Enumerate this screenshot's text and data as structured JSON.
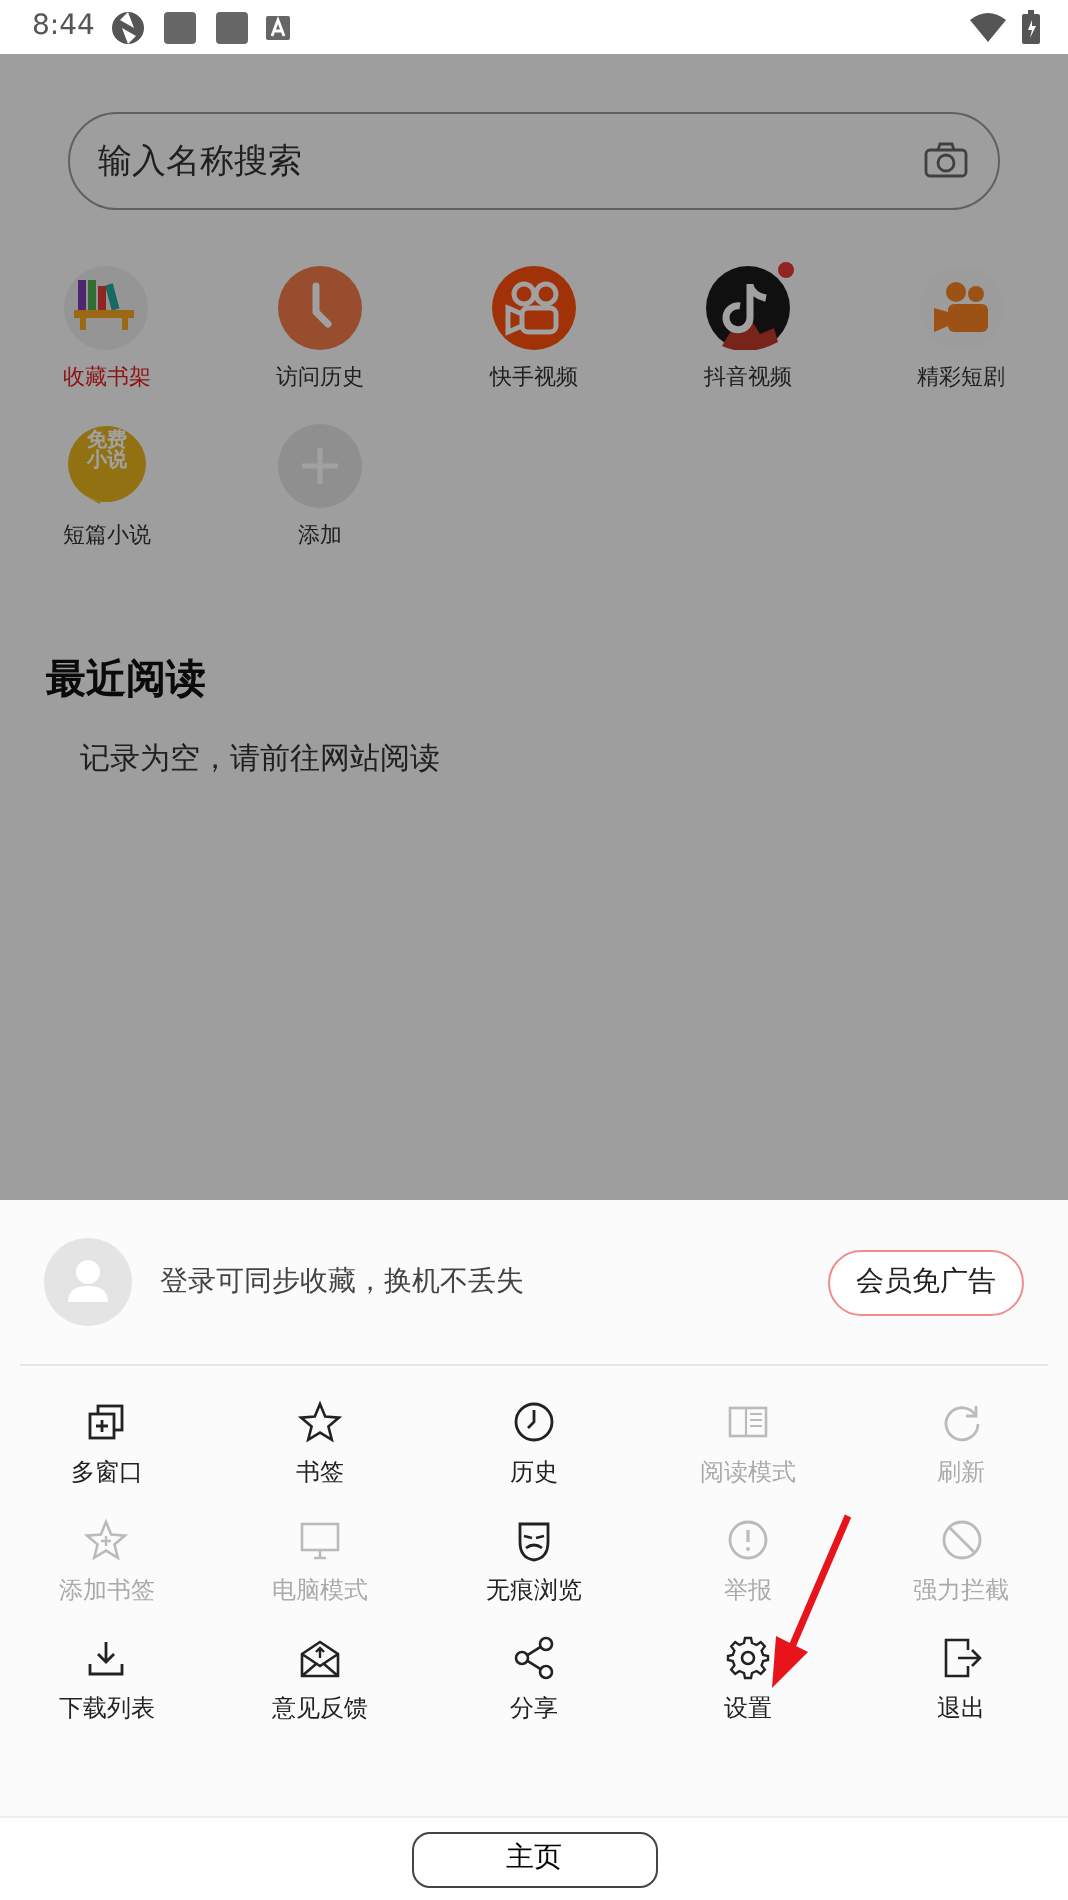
{
  "status_bar": {
    "time": "8:44"
  },
  "search": {
    "placeholder": "输入名称搜索"
  },
  "shortcuts": [
    {
      "label": "收藏书架",
      "kind": "bookshelf",
      "active": true,
      "dot": false
    },
    {
      "label": "访问历史",
      "kind": "clock",
      "active": false,
      "dot": false
    },
    {
      "label": "快手视频",
      "kind": "camera",
      "active": false,
      "dot": false
    },
    {
      "label": "抖音视频",
      "kind": "note",
      "active": false,
      "dot": true
    },
    {
      "label": "精彩短剧",
      "kind": "movie",
      "active": false,
      "dot": false
    },
    {
      "label": "短篇小说",
      "kind": "novel",
      "active": false,
      "dot": false,
      "badge_text": [
        "免费",
        "小说"
      ]
    },
    {
      "label": "添加",
      "kind": "add",
      "active": false,
      "dot": false
    }
  ],
  "recent": {
    "title": "最近阅读",
    "empty_text": "记录为空，请前往网站阅读"
  },
  "sheet": {
    "login_text": "登录可同步收藏，换机不丢失",
    "vip_button": "会员免广告",
    "menu": [
      {
        "label": "多窗口",
        "kind": "windows",
        "disabled": false
      },
      {
        "label": "书签",
        "kind": "star",
        "disabled": false
      },
      {
        "label": "历史",
        "kind": "clock",
        "disabled": false
      },
      {
        "label": "阅读模式",
        "kind": "reader",
        "disabled": true
      },
      {
        "label": "刷新",
        "kind": "refresh",
        "disabled": true
      },
      {
        "label": "添加书签",
        "kind": "star-add",
        "disabled": true
      },
      {
        "label": "电脑模式",
        "kind": "monitor",
        "disabled": true
      },
      {
        "label": "无痕浏览",
        "kind": "mask",
        "disabled": false
      },
      {
        "label": "举报",
        "kind": "alert",
        "disabled": true
      },
      {
        "label": "强力拦截",
        "kind": "block",
        "disabled": true
      },
      {
        "label": "下载列表",
        "kind": "download",
        "disabled": false
      },
      {
        "label": "意见反馈",
        "kind": "mail",
        "disabled": false
      },
      {
        "label": "分享",
        "kind": "share",
        "disabled": false
      },
      {
        "label": "设置",
        "kind": "gear",
        "disabled": false
      },
      {
        "label": "退出",
        "kind": "exit",
        "disabled": false
      }
    ]
  },
  "home_button": "主页"
}
